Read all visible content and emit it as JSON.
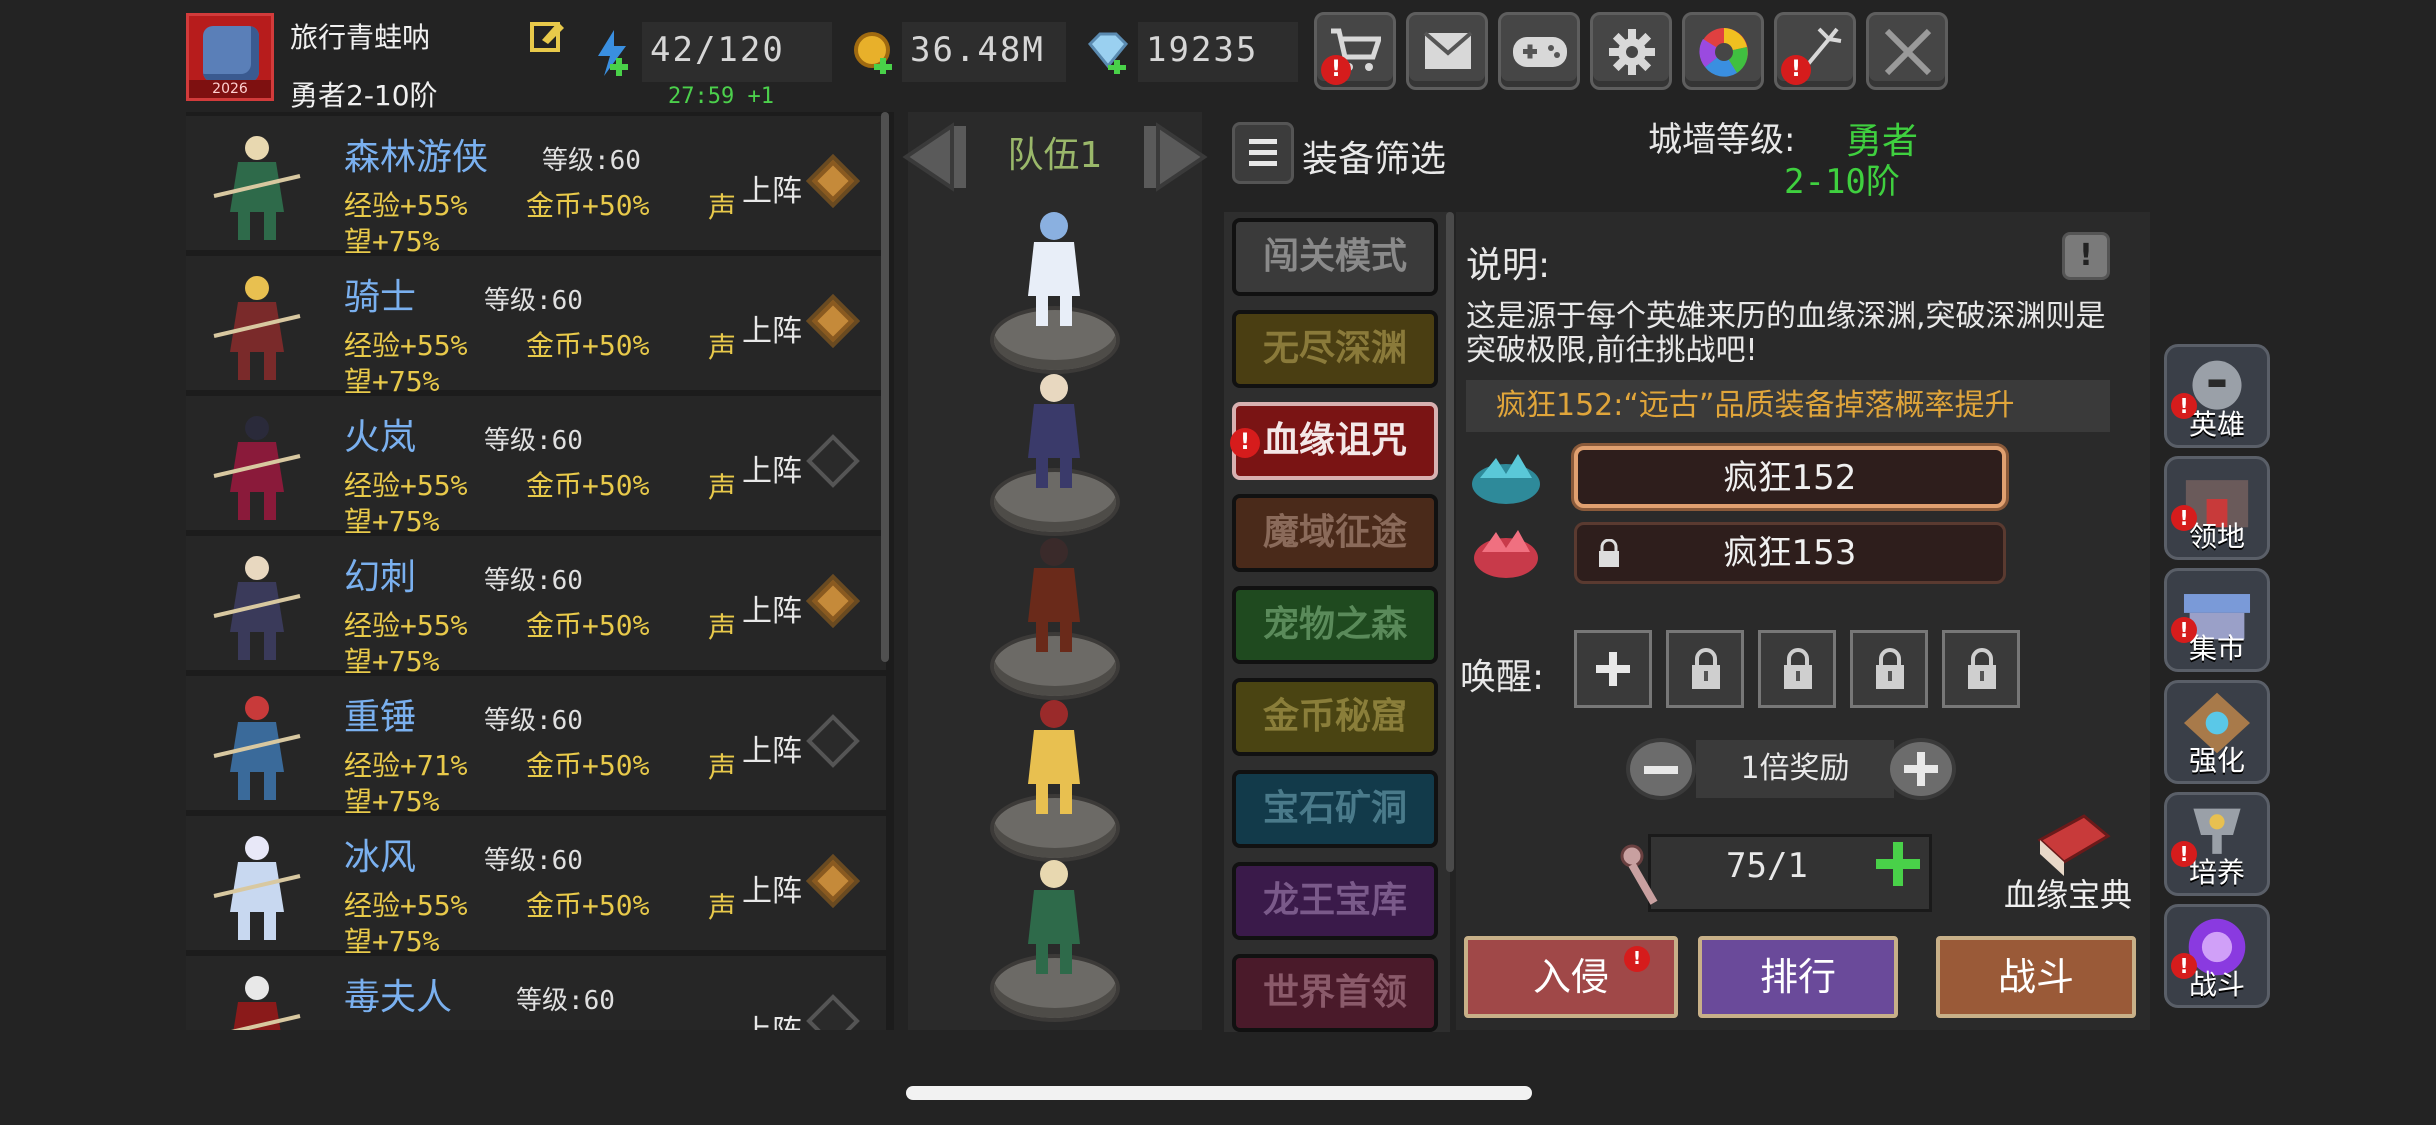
{
  "player": {
    "name": "旅行青蛙呐",
    "rank": "勇者2-10阶",
    "avatar_year": "2026"
  },
  "resources": {
    "energy": "42/120",
    "energy_timer": "27:59 +1",
    "gold": "36.48M",
    "gems": "19235"
  },
  "toolbar": [
    {
      "name": "shop",
      "icon": "cart-icon",
      "alert": true
    },
    {
      "name": "mail",
      "icon": "mail-icon",
      "alert": false
    },
    {
      "name": "controller",
      "icon": "gamepad-icon",
      "alert": false
    },
    {
      "name": "settings",
      "icon": "gear-icon",
      "alert": false
    },
    {
      "name": "wheel",
      "icon": "color-wheel-icon",
      "alert": false
    },
    {
      "name": "fireworks",
      "icon": "fireworks-icon",
      "alert": true
    },
    {
      "name": "battle-off",
      "icon": "crossed-swords-icon",
      "alert": false
    }
  ],
  "heroes": [
    {
      "name": "森林游侠",
      "level": "等级:60",
      "exp": "经验+55%",
      "gold": "金币+50%",
      "fame1": "声",
      "fame2": "望+75%",
      "deploy": "上阵",
      "selected": true
    },
    {
      "name": "骑士",
      "level": "等级:60",
      "exp": "经验+55%",
      "gold": "金币+50%",
      "fame1": "声",
      "fame2": "望+75%",
      "deploy": "上阵",
      "selected": true
    },
    {
      "name": "火岚",
      "level": "等级:60",
      "exp": "经验+55%",
      "gold": "金币+50%",
      "fame1": "声",
      "fame2": "望+75%",
      "deploy": "上阵",
      "selected": false
    },
    {
      "name": "幻刺",
      "level": "等级:60",
      "exp": "经验+55%",
      "gold": "金币+50%",
      "fame1": "声",
      "fame2": "望+75%",
      "deploy": "上阵",
      "selected": true
    },
    {
      "name": "重锤",
      "level": "等级:60",
      "exp": "经验+71%",
      "gold": "金币+50%",
      "fame1": "声",
      "fame2": "望+75%",
      "deploy": "上阵",
      "selected": false
    },
    {
      "name": "冰风",
      "level": "等级:60",
      "exp": "经验+55%",
      "gold": "金币+50%",
      "fame1": "声",
      "fame2": "望+75%",
      "deploy": "上阵",
      "selected": true
    },
    {
      "name": "毒夫人",
      "level": "等级:60",
      "exp": "",
      "gold": "",
      "fame1": "",
      "fame2": "",
      "deploy": "上阵",
      "selected": false
    }
  ],
  "team": {
    "label": "队伍1"
  },
  "filter": {
    "label": "装备筛选"
  },
  "wall": {
    "label": "城墙等级:",
    "value": "勇者",
    "sub": "2-10阶"
  },
  "modes": [
    {
      "label": "闯关模式",
      "bg": "#3a3a3a",
      "fg": "#8a8a8a",
      "alert": false
    },
    {
      "label": "无尽深渊",
      "bg": "#4a3e12",
      "fg": "#8a7a3a",
      "alert": false
    },
    {
      "label": "血缘诅咒",
      "bg": "#7a1414",
      "fg": "#f4e8e8",
      "alert": true
    },
    {
      "label": "魔域征途",
      "bg": "#4a2a1a",
      "fg": "#8a6a5a",
      "alert": false
    },
    {
      "label": "宠物之森",
      "bg": "#1f4a1f",
      "fg": "#5a8a5a",
      "alert": false
    },
    {
      "label": "金币秘窟",
      "bg": "#4a4412",
      "fg": "#8a7e3a",
      "alert": false
    },
    {
      "label": "宝石矿洞",
      "bg": "#123a4a",
      "fg": "#4a7a8a",
      "alert": false
    },
    {
      "label": "龙王宝库",
      "bg": "#3a1a4a",
      "fg": "#7a5a8a",
      "alert": false
    },
    {
      "label": "世界首领",
      "bg": "#4a1a2a",
      "fg": "#8a5a6a",
      "alert": false
    }
  ],
  "detail": {
    "title": "说明:",
    "help": "!",
    "description": "这是源于每个英雄来历的血缘深渊,突破深渊则是突破极限,前往挑战吧!",
    "bonus": "疯狂152:“远古”品质装备掉落概率提升",
    "stages": [
      {
        "label": "疯狂152",
        "locked": false
      },
      {
        "label": "疯狂153",
        "locked": true
      }
    ],
    "awaken_label": "唤醒:",
    "reward_label": "1倍奖励",
    "tickets": "75/1",
    "codex_label": "血缘宝典"
  },
  "actions": [
    {
      "label": "入侵",
      "alert": true,
      "bg": "#a04848"
    },
    {
      "label": "排行",
      "alert": false,
      "bg": "#6a4a9a"
    },
    {
      "label": "战斗",
      "alert": false,
      "bg": "#9a5a38"
    }
  ],
  "side_menu": [
    {
      "label": "英雄",
      "alert": true
    },
    {
      "label": "领地",
      "alert": true
    },
    {
      "label": "集市",
      "alert": true
    },
    {
      "label": "强化",
      "alert": false
    },
    {
      "label": "培养",
      "alert": true
    },
    {
      "label": "战斗",
      "alert": true
    }
  ]
}
